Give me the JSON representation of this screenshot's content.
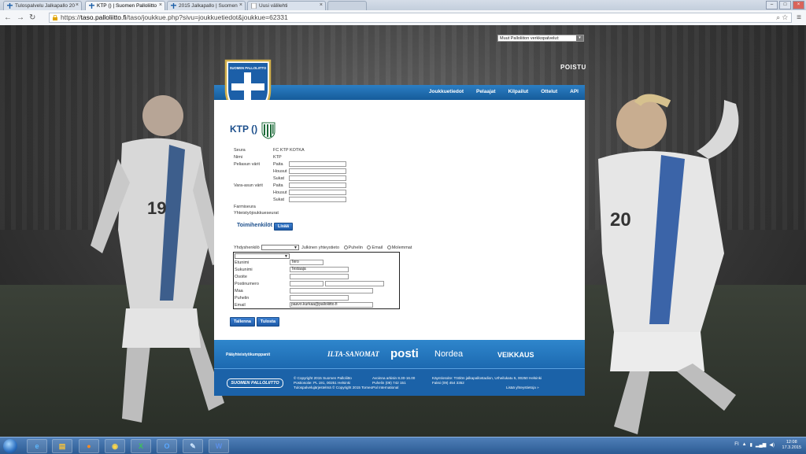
{
  "browser": {
    "tabs": [
      {
        "label": "Tulospalvelu Jalkapallo 20",
        "active": false
      },
      {
        "label": "KTP () | Suomen Palloliitto",
        "active": true
      },
      {
        "label": "2015 Jalkapallo | Suomen",
        "active": false
      },
      {
        "label": "Uusi välilehti",
        "active": false
      }
    ],
    "url_prefix": "https://",
    "url_host": "taso.palloliitto.fi",
    "url_rest": "/taso/joukkue.php?sivu=joukkuetiedot&joukkue=62331"
  },
  "header": {
    "services_select": "Muut Palloliiton verkkopalvelut:",
    "logout": "POISTU",
    "shield_text": "SUOMEN PALLOLIITTO",
    "nav": [
      "Joukkuetiedot",
      "Pelaajat",
      "Kilpailut",
      "Ottelut",
      "API"
    ]
  },
  "team": {
    "title": "KTP ()",
    "fields": {
      "seura_label": "Seura",
      "seura_value": "FC KTP KOTKA",
      "nimi_label": "Nimi",
      "nimi_value": "KTP",
      "peliasun_label": "Peliasun värit",
      "vara_label": "Vara-asun värit",
      "paita": "Paita",
      "housut": "Housut",
      "sukat": "Sukat",
      "farmiseura": "Farmiseura",
      "yhteistyo": "Yhteistyöjoukkueseurat"
    }
  },
  "officials": {
    "title": "Toimihenkilöt",
    "add_button": "Lisää",
    "contact_label": "Yhdyshenkilö",
    "public_label": "Julkinen yhteystieto",
    "radio_options": [
      "Puhelin",
      "Email",
      "Molemmat"
    ],
    "contact_fields": {
      "etunimi_label": "Etunimi",
      "etunimi_value": "Tero",
      "sukunimi_label": "Sukunimi",
      "sukunimi_value": "Testaaja",
      "osoite_label": "Osoite",
      "postinumero_label": "Postinumero",
      "maa_label": "Maa",
      "puhelin_label": "Puhelin",
      "email_label": "Email",
      "email_value": "paavo.kurkaa@palloliitto.fi"
    }
  },
  "actions": {
    "save": "Tallenna",
    "print": "Tulosta"
  },
  "sponsors": {
    "label": "Pääyhteistyökumppanit",
    "names": [
      "ILTA-SANOMAT",
      "posti",
      "Nordea",
      "VEIKKAUS"
    ]
  },
  "footer": {
    "logo": "SUOMEN PALLOLIITTO",
    "col1": [
      "© Copyright 2015 Suomen Palloliitto",
      "Postiosoite: PL 191, 00251 Helsinki",
      "Tulospalvelujärjestelmä © Copyright 2015 TorneoPal International"
    ],
    "col2": [
      "Avoinna arkisin 8.30-16.00",
      "Puhelin (09) 742 151"
    ],
    "col3": [
      "Käyntiosoite: Töölön jalkapallostadion, Urheilukatu 5, 00250 Helsinki",
      "Faksi (09) 454 3352",
      "Lisää yhteystietoja »"
    ]
  },
  "taskbar": {
    "lang": "FI",
    "time": "12:08",
    "date": "17.3.2015"
  },
  "colors": {
    "brand_blue": "#1b62a8",
    "nav_blue": "#2c7fc4"
  }
}
